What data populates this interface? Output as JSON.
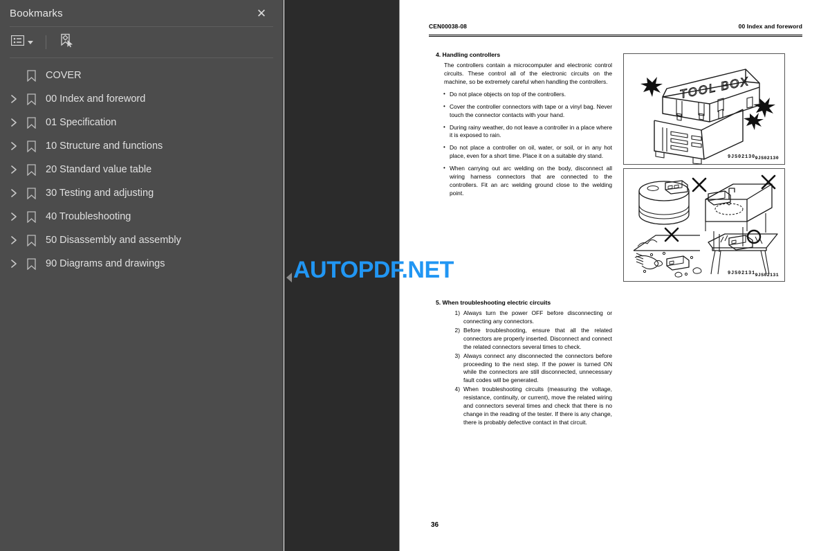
{
  "sidebar": {
    "title": "Bookmarks",
    "close_label": "✕",
    "toolbar": {
      "options_icon": "list-options-icon",
      "options_caret": "chevron-down-icon",
      "new_bookmark_icon": "new-bookmark-icon"
    },
    "items": [
      {
        "label": "COVER",
        "expandable": false
      },
      {
        "label": "00 Index and foreword",
        "expandable": true
      },
      {
        "label": "01 Specification",
        "expandable": true
      },
      {
        "label": "10 Structure and functions",
        "expandable": true
      },
      {
        "label": "20 Standard value table",
        "expandable": true
      },
      {
        "label": "30 Testing and adjusting",
        "expandable": true
      },
      {
        "label": "40 Troubleshooting",
        "expandable": true
      },
      {
        "label": "50 Disassembly and assembly",
        "expandable": true
      },
      {
        "label": "90 Diagrams and drawings",
        "expandable": true
      }
    ]
  },
  "viewer": {
    "watermark": "AUTOPDF.NET",
    "watermark_color": "#2196f3",
    "collapse_handle_icon": "collapse-left-arrow-icon",
    "gutter_color": "#2b2b2b",
    "panel_color": "#4c4c4c"
  },
  "document": {
    "header_left": "CEN00038-08",
    "header_right": "00 Index and foreword",
    "page_number": "36",
    "section4": {
      "title": "4. Handling controllers",
      "intro": "The controllers contain a microcomputer and electronic control circuits. These control all of the electronic circuits on the machine, so be extremely careful when handling the controllers.",
      "bullets": [
        "Do not place objects on top of the controllers.",
        "Cover the controller connectors with tape or a vinyl bag. Never touch the connector contacts with your hand.",
        "During rainy weather, do not leave a controller in a place where it is exposed to rain.",
        "Do not place a controller on oil, water, or soil, or in any hot place, even for a short time. Place it on a suitable dry stand.",
        "When carrying out arc welding on the body, disconnect all wiring harness connectors that are connected to the controllers. Fit an arc welding ground close to the welding point."
      ]
    },
    "section5": {
      "title": "5. When troubleshooting electric circuits",
      "items": [
        {
          "marker": "1)",
          "text": "Always turn the power OFF before disconnecting or connecting any connectors."
        },
        {
          "marker": "2)",
          "text": "Before troubleshooting, ensure that all the related connectors are properly inserted. Disconnect and connect the related connectors several times to check."
        },
        {
          "marker": "3)",
          "text": "Always connect any disconnected the connectors before proceeding to the next step. If the power is turned ON while the connectors are still disconnected, unnecessary fault codes will be generated."
        },
        {
          "marker": "4)",
          "text": "When troubleshooting circuits (measuring the voltage, resistance, continuity, or current), move the related wiring and connectors several times and check that there is no change in the reading of the tester. If there is any change, there is probably defective contact in that circuit."
        }
      ]
    },
    "figures": [
      {
        "id": "9JS02130",
        "caption_text": "TOOL BOX",
        "name": "toolbox-illustration"
      },
      {
        "id": "9JS02131",
        "caption_text": "",
        "name": "controller-handling-illustration"
      }
    ]
  }
}
